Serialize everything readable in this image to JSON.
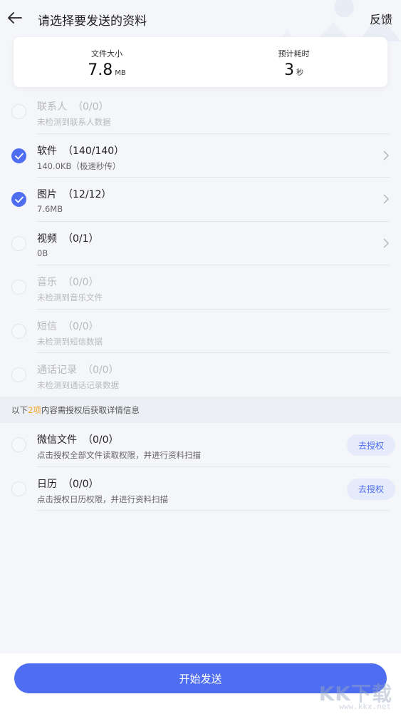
{
  "header": {
    "title": "请选择要发送的资料",
    "feedback_label": "反馈"
  },
  "summary": {
    "file_size_label": "文件大小",
    "file_size_value": "7.8",
    "file_size_unit": "MB",
    "time_label": "预计耗时",
    "time_value": "3",
    "time_unit": "秒"
  },
  "items": [
    {
      "title": "联系人",
      "count": "（0/0）",
      "subtitle": "未检测到联系人数据",
      "checked": false,
      "disabled": true,
      "chevron": false
    },
    {
      "title": "软件",
      "count": "（140/140）",
      "subtitle": "140.0KB（极速秒传）",
      "checked": true,
      "disabled": false,
      "chevron": true
    },
    {
      "title": "图片",
      "count": "（12/12）",
      "subtitle": "7.6MB",
      "checked": true,
      "disabled": false,
      "chevron": true
    },
    {
      "title": "视频",
      "count": "（0/1）",
      "subtitle": "0B",
      "checked": false,
      "disabled": false,
      "chevron": true
    },
    {
      "title": "音乐",
      "count": "（0/0）",
      "subtitle": "未检测到音乐文件",
      "checked": false,
      "disabled": true,
      "chevron": false
    },
    {
      "title": "短信",
      "count": "（0/0）",
      "subtitle": "未检测到短信数据",
      "checked": false,
      "disabled": true,
      "chevron": false
    },
    {
      "title": "通话记录",
      "count": "（0/0）",
      "subtitle": "未检测到通话记录数据",
      "checked": false,
      "disabled": true,
      "chevron": false
    }
  ],
  "auth_note": {
    "prefix": "以下",
    "highlight": "2项",
    "suffix": "内容需授权后获取详情信息",
    "highlight_color": "#f5a623"
  },
  "auth_items": [
    {
      "title": "微信文件",
      "count": "（0/0）",
      "subtitle": "点击授权全部文件读取权限，并进行资料扫描",
      "button_label": "去授权"
    },
    {
      "title": "日历",
      "count": "（0/0）",
      "subtitle": "点击授权日历权限，并进行资料扫描",
      "button_label": "去授权"
    }
  ],
  "footer": {
    "start_label": "开始发送"
  },
  "watermark": {
    "big": "KK下载",
    "small": "www.kkx.net"
  },
  "colors": {
    "accent": "#4f6df0",
    "background": "#f5f6fa"
  },
  "icons": [
    "back-arrow-icon",
    "checkmark-icon",
    "chevron-right-icon"
  ]
}
